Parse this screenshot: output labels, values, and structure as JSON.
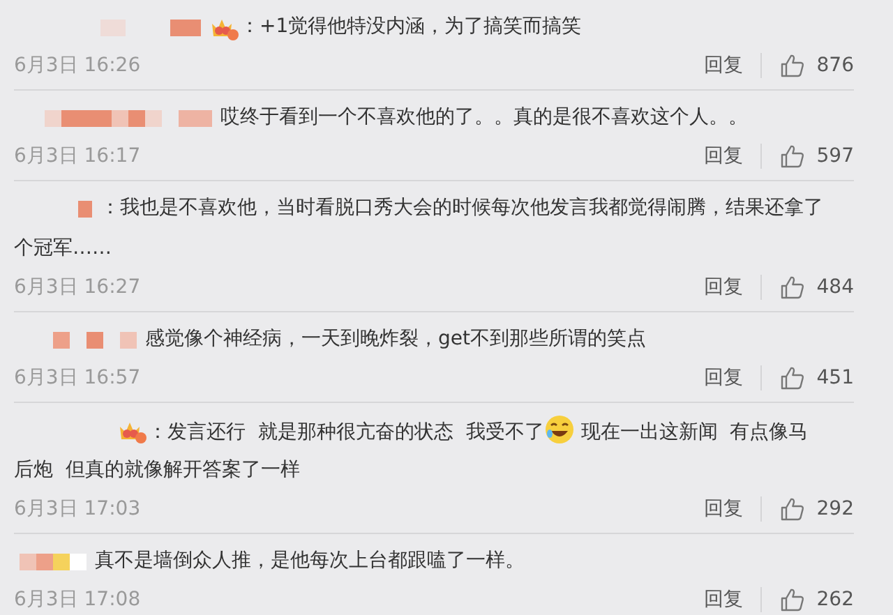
{
  "comments": [
    {
      "crown_badge": true,
      "lines": [
        [
          {
            "kind": "text",
            "value": "：+1觉得他特没内涵，为了搞笑而搞笑"
          }
        ]
      ],
      "time": "6月3日 16:26",
      "reply": "回复",
      "likes": "876"
    },
    {
      "crown_badge": false,
      "lines": [
        [
          {
            "kind": "text",
            "value": "哎终于看到一个不喜欢他的了。。真的是很不喜欢这个人。。"
          }
        ]
      ],
      "time": "6月3日 16:17",
      "reply": "回复",
      "likes": "597"
    },
    {
      "crown_badge": false,
      "lines": [
        [
          {
            "kind": "text",
            "value": "：我也是不喜欢他，当时看脱口秀大会的时候每次他发言我都觉得闹腾，结果还拿了"
          }
        ],
        [
          {
            "kind": "text",
            "value": "个冠军……"
          }
        ]
      ],
      "time": "6月3日 16:27",
      "reply": "回复",
      "likes": "484"
    },
    {
      "crown_badge": false,
      "lines": [
        [
          {
            "kind": "text",
            "value": "感觉像个神经病，一天到晚炸裂，get不到那些所谓的笑点"
          }
        ]
      ],
      "time": "6月3日 16:57",
      "reply": "回复",
      "likes": "451"
    },
    {
      "crown_badge": true,
      "lines": [
        [
          {
            "kind": "text",
            "value": "：发言还行  就是那种很亢奋的状态  我受不了"
          },
          {
            "kind": "emoji"
          },
          {
            "kind": "text",
            "value": " 现在一出这新闻  有点像马"
          }
        ],
        [
          {
            "kind": "text",
            "value": "后炮  但真的就像解开答案了一样"
          }
        ]
      ],
      "time": "6月3日 17:03",
      "reply": "回复",
      "likes": "292"
    },
    {
      "crown_badge": false,
      "lines": [
        [
          {
            "kind": "text",
            "value": "真不是墙倒众人推，是他每次上台都跟嗑了一样。"
          }
        ]
      ],
      "time": "6月3日 17:08",
      "reply": "回复",
      "likes": "262"
    }
  ]
}
